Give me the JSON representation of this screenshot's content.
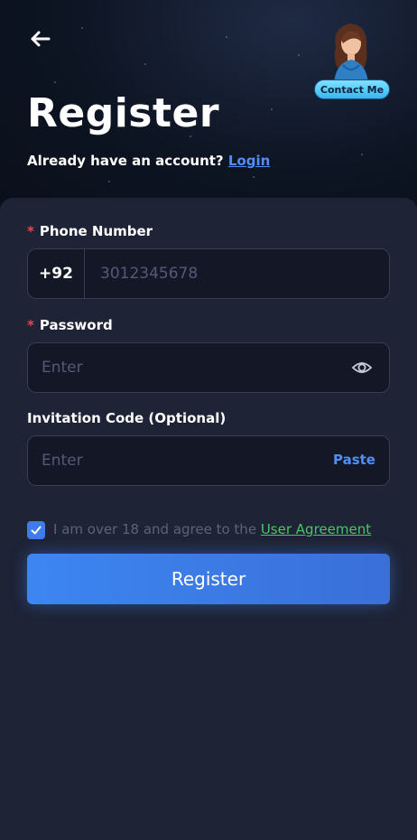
{
  "header": {
    "title": "Register",
    "login_prompt": "Already have an account?",
    "login_link": "Login",
    "contact_label": "Contact Me"
  },
  "form": {
    "phone": {
      "required_mark": "*",
      "label": "Phone Number",
      "country_code": "+92",
      "placeholder": "3012345678"
    },
    "password": {
      "required_mark": "*",
      "label": "Password",
      "placeholder": "Enter",
      "toggle_icon": "eye-icon"
    },
    "invitation": {
      "label": "Invitation Code (Optional)",
      "placeholder": "Enter",
      "paste_label": "Paste"
    },
    "agreement": {
      "checked": true,
      "text": "I am over 18 and agree to the",
      "link": "User Agreement"
    },
    "submit_label": "Register"
  },
  "colors": {
    "accent": "#3d86f2",
    "link_blue": "#4f8ff6",
    "link_green": "#4cc36a",
    "required": "#e5484d",
    "background": "#1e2335"
  }
}
